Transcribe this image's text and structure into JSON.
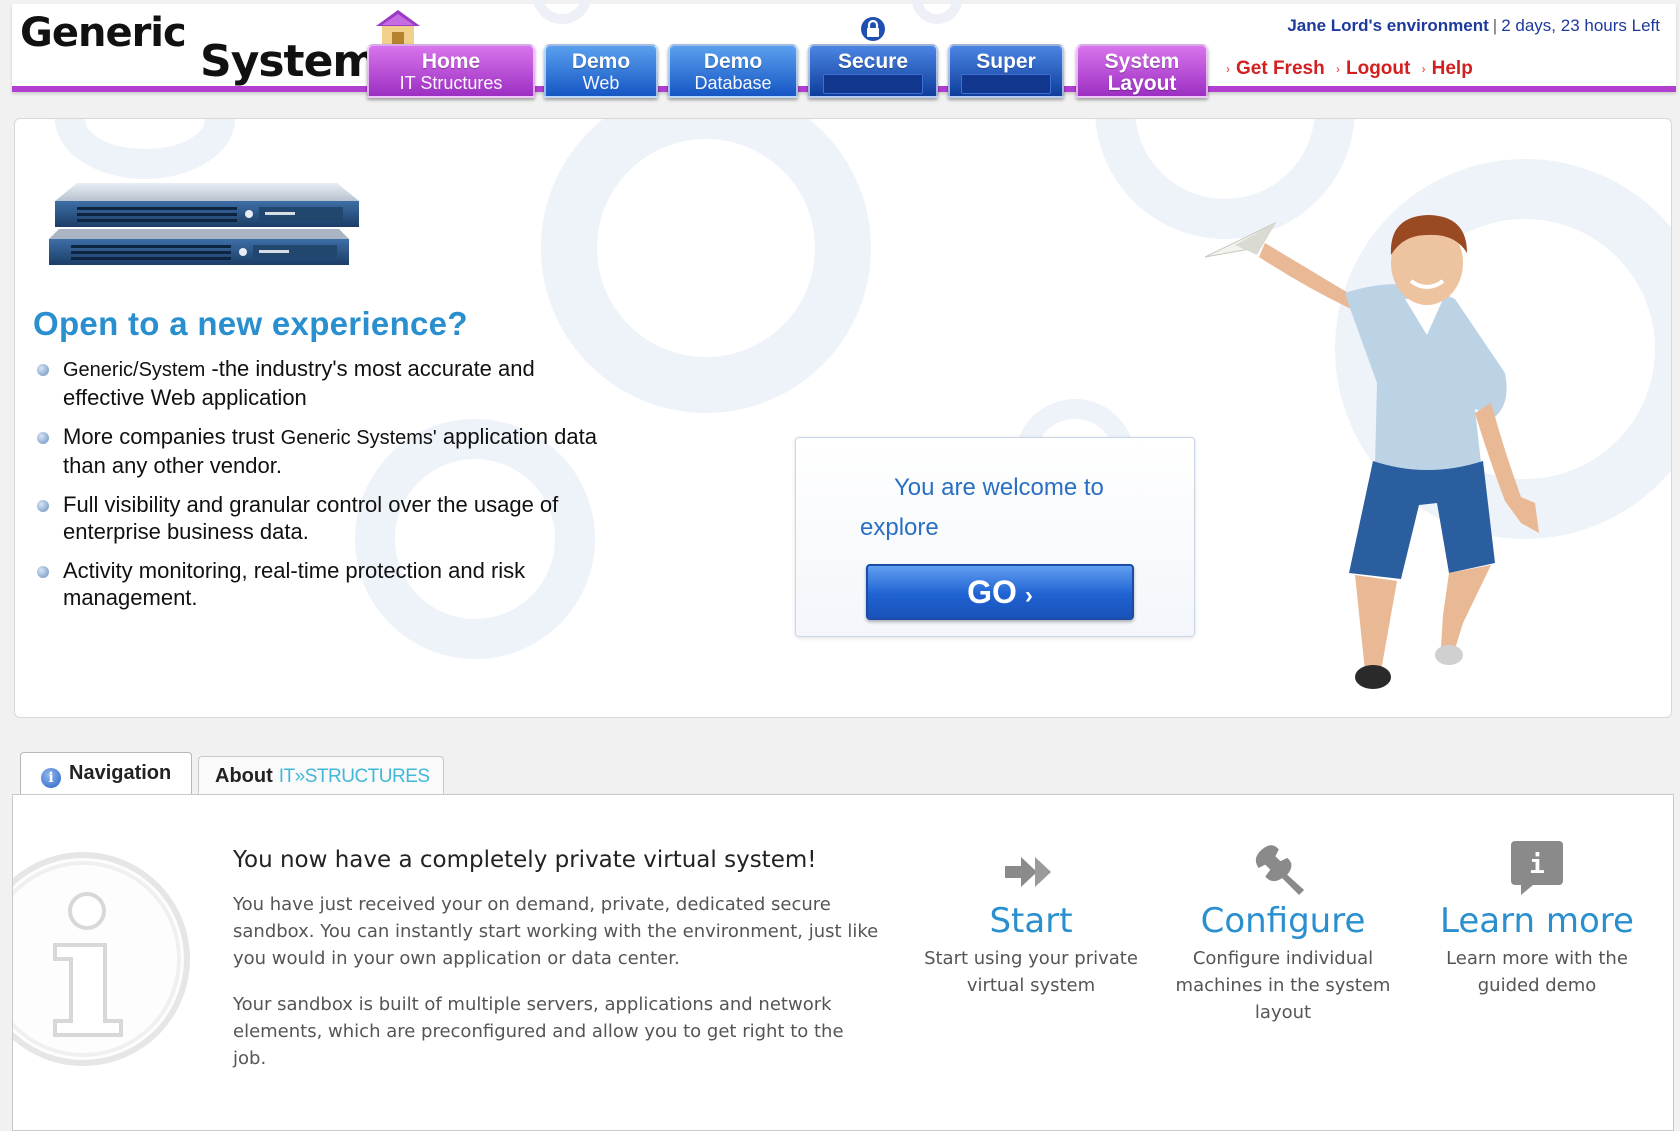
{
  "logo": {
    "line1": "Generic",
    "line2": "System"
  },
  "nav_tabs": [
    {
      "title": "Home",
      "subtitle": "IT Structures"
    },
    {
      "title": "Demo",
      "subtitle": "Web"
    },
    {
      "title": "Demo",
      "subtitle": "Database"
    },
    {
      "title": "Secure",
      "subtitle": ""
    },
    {
      "title": "Super",
      "subtitle": ""
    },
    {
      "title": "System",
      "subtitle": "Layout"
    }
  ],
  "env": {
    "owner": "Jane Lord's environment",
    "time_left": "2 days, 23 hours Left"
  },
  "top_links": {
    "get_fresh": "Get Fresh",
    "logout": "Logout",
    "help": "Help"
  },
  "hero": {
    "title": "Open to a new experience?",
    "bullets": [
      {
        "brand": "Generic/System",
        "text": " -the industry's most accurate and effective Web application"
      },
      {
        "pre": "More companies trust ",
        "brand": "Generic Systems'",
        "text": " application data than any other vendor."
      },
      {
        "text": "Full visibility and granular control over the usage of enterprise business data."
      },
      {
        "text": "Activity monitoring, real-time protection and risk management."
      }
    ],
    "welcome_line1": "You are welcome to",
    "welcome_line2": "explore",
    "go_label": "GO",
    "go_chevron": "›"
  },
  "tabs": {
    "navigation": "Navigation",
    "about": "About",
    "about_brand": "IT»STRUCTURES"
  },
  "panel": {
    "title": "You now have a completely private virtual system!",
    "p1": "You have just received your on demand, private, dedicated secure sandbox. You can instantly start working with the environment, just like you would in your own application or data center.",
    "p2": "Your sandbox is built of multiple servers, applications and network elements, which are preconfigured and allow you to get right to the job.",
    "actions": [
      {
        "title": "Start",
        "desc": "Start using your private virtual system",
        "icon": "double-arrow-icon"
      },
      {
        "title": "Configure",
        "desc": "Configure individual machines in the system layout",
        "icon": "wrench-icon"
      },
      {
        "title": "Learn more",
        "desc": "Learn more with the guided demo",
        "icon": "info-speech-icon"
      }
    ]
  },
  "colors": {
    "accent_purple": "#b13fd0",
    "link_red": "#d21f1f",
    "title_blue": "#2a8fce",
    "button_blue": "#1f62d2"
  }
}
